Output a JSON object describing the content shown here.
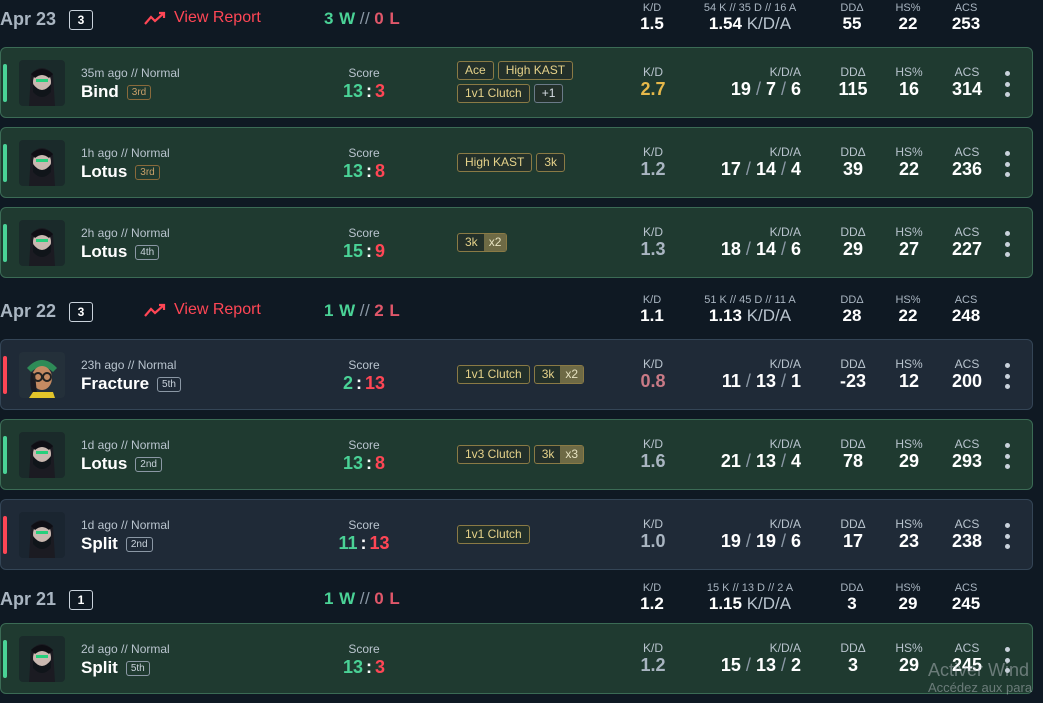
{
  "labels": {
    "view_report": "View Report",
    "kd": "K/D",
    "kda": "K/D/A",
    "dd": "DDΔ",
    "hs": "HS%",
    "acs": "ACS",
    "score": "Score"
  },
  "days": [
    {
      "date": "Apr 23",
      "count": "3",
      "wins": "3 W",
      "losses": "0 L",
      "kd": "1.5",
      "kda_detail": "54 K // 35 D // 16 A",
      "kda_ratio": "1.54",
      "dd": "55",
      "hs": "22",
      "acs": "253"
    },
    {
      "date": "Apr 22",
      "count": "3",
      "wins": "1 W",
      "losses": "2 L",
      "kd": "1.1",
      "kda_detail": "51 K // 45 D // 11 A",
      "kda_ratio": "1.13",
      "dd": "28",
      "hs": "22",
      "acs": "248"
    },
    {
      "date": "Apr 21",
      "count": "1",
      "wins": "1 W",
      "losses": "0 L",
      "kd": "1.2",
      "kda_detail": "15 K // 13 D // 2 A",
      "kda_ratio": "1.15",
      "dd": "3",
      "hs": "29",
      "acs": "245"
    }
  ],
  "matches": [
    {
      "result": "win",
      "agent": "viper",
      "ago": "35m ago // Normal",
      "map": "Bind",
      "place": "3rd",
      "score_a": "13",
      "score_b": "3",
      "tags": [
        "Ace",
        "High KAST",
        "1v1 Clutch",
        "+1"
      ],
      "tags_mult": [],
      "kd": "2.7",
      "k": "19",
      "d": "7",
      "a": "6",
      "dd": "115",
      "hs": "16",
      "acs": "314"
    },
    {
      "result": "win",
      "agent": "viper",
      "ago": "1h ago // Normal",
      "map": "Lotus",
      "place": "3rd",
      "score_a": "13",
      "score_b": "8",
      "tags": [
        "High KAST",
        "3k"
      ],
      "tags_mult": [],
      "kd": "1.2",
      "k": "17",
      "d": "14",
      "a": "4",
      "dd": "39",
      "hs": "22",
      "acs": "236"
    },
    {
      "result": "win",
      "agent": "viper",
      "ago": "2h ago // Normal",
      "map": "Lotus",
      "place": "4th",
      "score_a": "15",
      "score_b": "9",
      "tags": [
        "3k"
      ],
      "tags_mult": [
        "x2"
      ],
      "kd": "1.3",
      "k": "18",
      "d": "14",
      "a": "6",
      "dd": "29",
      "hs": "27",
      "acs": "227"
    },
    {
      "result": "loss",
      "agent": "killjoy",
      "ago": "23h ago // Normal",
      "map": "Fracture",
      "place": "5th",
      "score_a": "2",
      "score_b": "13",
      "tags": [
        "1v1 Clutch",
        "3k"
      ],
      "tags_mult": [
        "",
        "x2"
      ],
      "kd": "0.8",
      "k": "11",
      "d": "13",
      "a": "1",
      "dd": "-23",
      "hs": "12",
      "acs": "200"
    },
    {
      "result": "win",
      "agent": "viper",
      "ago": "1d ago // Normal",
      "map": "Lotus",
      "place": "2nd",
      "score_a": "13",
      "score_b": "8",
      "tags": [
        "1v3 Clutch",
        "3k"
      ],
      "tags_mult": [
        "",
        "x3"
      ],
      "kd": "1.6",
      "k": "21",
      "d": "13",
      "a": "4",
      "dd": "78",
      "hs": "29",
      "acs": "293"
    },
    {
      "result": "loss",
      "agent": "viper",
      "ago": "1d ago // Normal",
      "map": "Split",
      "place": "2nd",
      "score_a": "11",
      "score_b": "13",
      "tags": [
        "1v1 Clutch"
      ],
      "tags_mult": [],
      "kd": "1.0",
      "k": "19",
      "d": "19",
      "a": "6",
      "dd": "17",
      "hs": "23",
      "acs": "238"
    },
    {
      "result": "win",
      "agent": "viper",
      "ago": "2d ago // Normal",
      "map": "Split",
      "place": "5th",
      "score_a": "13",
      "score_b": "3",
      "tags": [],
      "tags_mult": [],
      "kd": "1.2",
      "k": "15",
      "d": "13",
      "a": "2",
      "dd": "3",
      "hs": "29",
      "acs": "245"
    }
  ],
  "watermark": {
    "line1": "Activer Wind",
    "line2": "Accédez aux para"
  },
  "colors": {
    "win": "#4ad296",
    "loss": "#ff4655",
    "background": "#0f1923",
    "win_card": "#1f3a30",
    "loss_card": "#1f2a37",
    "tag_text": "#e6d28a"
  }
}
